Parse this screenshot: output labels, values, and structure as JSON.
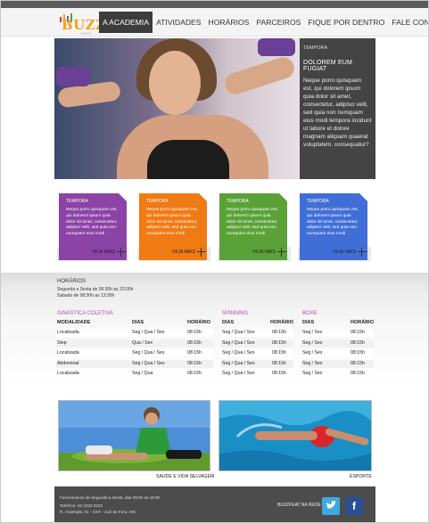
{
  "brand": {
    "logo_text": "BUZZ",
    "logo_sub": "FEAT",
    "accent": "#f3a21b"
  },
  "nav": {
    "items": [
      "A ACADEMIA",
      "ATIVIDADES",
      "HORÁRIOS",
      "PARCEIROS",
      "FIQUE POR DENTRO",
      "FALE CONOSCO"
    ],
    "active_index": 0
  },
  "hero": {
    "tag": "TEMPORA",
    "title": "DOLOREM EUM FUGIAT",
    "body": "Neque porro quisquam est, qui dolorem ipsum quia dolor sit amet, consectetur, adipisci velit, sed quia non numquam eius modi tempora incidunt ut labore et dolore magnam aliquam quaerat voluptatem. consequatur?"
  },
  "cards": [
    {
      "tag": "TEMPORA",
      "body": "Neque porro quisquam est, qui dolorem ipsum quia dolor sit amet, consectetur, adipisci velit, sed quia non numquam eius modi",
      "more": "VEJA MAIS",
      "color": "#8b43a6"
    },
    {
      "tag": "TEMPORA",
      "body": "Neque porro quisquam est, qui dolorem ipsum quia dolor sit amet, consectetur, adipisci velit, sed quia non numquam eius modi",
      "more": "VEJA MAIS",
      "color": "#f07a14"
    },
    {
      "tag": "TEMPORA",
      "body": "Neque porro quisquam est, qui dolorem ipsum quia dolor sit amet, consectetur, adipisci velit, sed quia non numquam eius modi",
      "more": "VEJA MAIS",
      "color": "#5aa237"
    },
    {
      "tag": "TEMPORA",
      "body": "Neque porro quisquam est, qui dolorem ipsum quia dolor sit amet, consectetur, adipisci velit, sed quia non numquam eius modi",
      "more": "VEJA MAIS",
      "color": "#3f6fd6"
    }
  ],
  "schedule": {
    "title": "HORÁRIOS",
    "lines": [
      "Segunda a Sexta de 06:30h as 22:00h",
      "Sabado de 08:30h as 13:30h"
    ],
    "ginastica": {
      "heading": "GINÁSTICA COLETIVA",
      "heading_color": "#b04bb0",
      "columns": [
        "MODALIDADE",
        "DIAS",
        "HORÁRIO"
      ],
      "rows": [
        [
          "Localizada",
          "Seg / Qua / Sex",
          "08:15h"
        ],
        [
          "Step",
          "Qua / Sex",
          "08:15h"
        ],
        [
          "Localizada",
          "Seg / Qua / Sex",
          "08:15h"
        ],
        [
          "Abdominal",
          "Seg / Qua / Sex",
          "08:15h"
        ],
        [
          "Localizada",
          "Seg / Qua",
          "08:15h"
        ]
      ]
    },
    "spinning": {
      "heading": "SPINNING",
      "heading_color": "#b04bb0",
      "columns": [
        "DIAS",
        "HORÁRIO"
      ],
      "rows": [
        [
          "Seg / Qua / Sex",
          "08:15h"
        ],
        [
          "Seg / Qua / Sex",
          "08:15h"
        ],
        [
          "Seg / Qua / Sex",
          "08:15h"
        ],
        [
          "Seg / Qua / Sex",
          "08:15h"
        ],
        [
          "Seg / Qua / Sex",
          "08:15h"
        ]
      ]
    },
    "boxe": {
      "heading": "BOXE",
      "heading_color": "#b04bb0",
      "columns": [
        "DIAS",
        "HORÁRIO"
      ],
      "rows": [
        [
          "Seg / Sex",
          "08:15h"
        ],
        [
          "Seg / Sex",
          "08:15h"
        ],
        [
          "Seg / Sex",
          "08:15h"
        ],
        [
          "Seg / Sex",
          "08:15h"
        ],
        [
          "Seg / Sex",
          "08:15h"
        ]
      ]
    }
  },
  "photos": [
    {
      "caption": "SAUDE E VIDA SELVAGEM"
    },
    {
      "caption": "ESPORTE"
    }
  ],
  "footer": {
    "lines": [
      "Funcionamos de Segunda a Sexta, das 09:00 as 18:00",
      "Telefone: 32 3232.3232",
      "R.: Exemplo, 01 - XXX - Juiz de Fora, MG"
    ],
    "network_label": "BUZZFEAT NA REDE",
    "twitter_color": "#3fa9e0",
    "facebook_color": "#2a4f94"
  }
}
